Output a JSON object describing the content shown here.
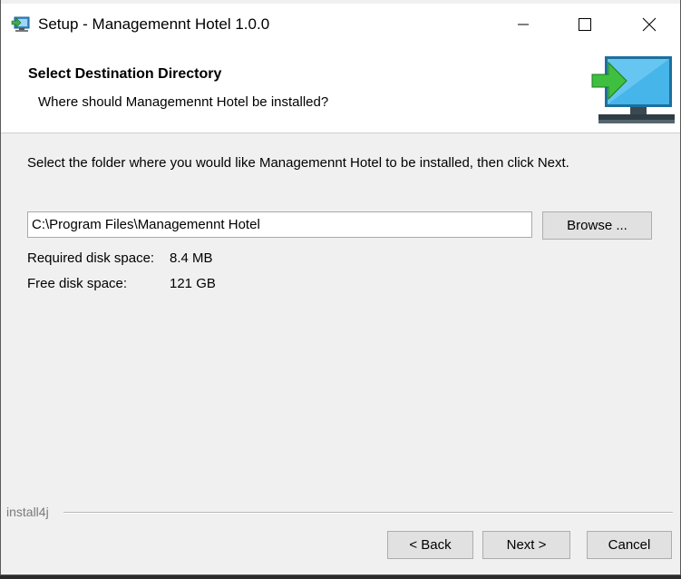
{
  "window": {
    "title": "Setup - Managemennt Hotel 1.0.0"
  },
  "header": {
    "title": "Select Destination Directory",
    "subtitle": "Where should Managemennt Hotel be installed?"
  },
  "content": {
    "instruction": "Select the folder where you would like Managemennt Hotel to be installed, then click Next.",
    "path_value": "C:\\Program Files\\Managemennt Hotel",
    "browse_label": "Browse ...",
    "required_label": "Required disk space:",
    "required_value": "8.4 MB",
    "free_label": "Free disk space:",
    "free_value": "121 GB"
  },
  "footer": {
    "brand": "install4j",
    "back_label": "< Back",
    "next_label": "Next >",
    "cancel_label": "Cancel"
  },
  "colors": {
    "window_bg": "#f0f0f0",
    "header_bg": "#ffffff",
    "button_bg": "#e1e1e1",
    "icon_green": "#4caf50",
    "icon_screen": "#29a8e0"
  }
}
